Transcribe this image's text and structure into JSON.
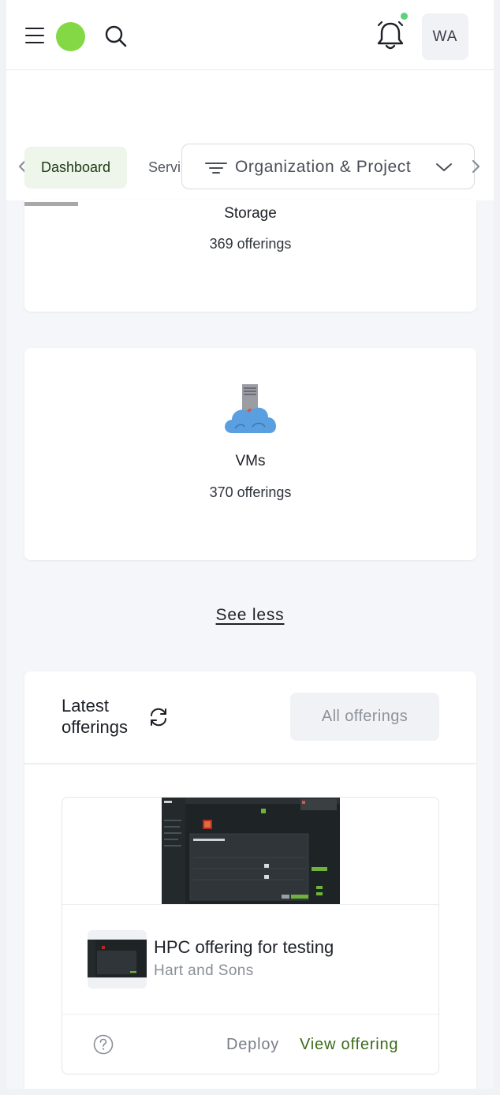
{
  "header": {
    "avatar_initials": "WA",
    "logo_color": "#84d845",
    "notification_dot_color": "#5cd27b"
  },
  "nav": {
    "tabs": [
      {
        "label": "Dashboard",
        "active": true
      },
      {
        "label": "Servi",
        "active": false
      }
    ],
    "org_selector_label": "Organization & Project"
  },
  "categories": [
    {
      "title": "Storage",
      "count_label": "369 offerings"
    },
    {
      "title": "VMs",
      "count_label": "370 offerings"
    }
  ],
  "see_less_label": "See less",
  "latest": {
    "title_line1": "Latest",
    "title_line2": "offerings",
    "all_offerings_label": "All offerings",
    "offerings": [
      {
        "name": "HPC offering for testing",
        "vendor": "Hart and Sons",
        "deploy_label": "Deploy",
        "view_label": "View offering"
      }
    ]
  },
  "colors": {
    "accent_green": "#3c6a1a",
    "active_tab_bg": "#eef5ea"
  }
}
